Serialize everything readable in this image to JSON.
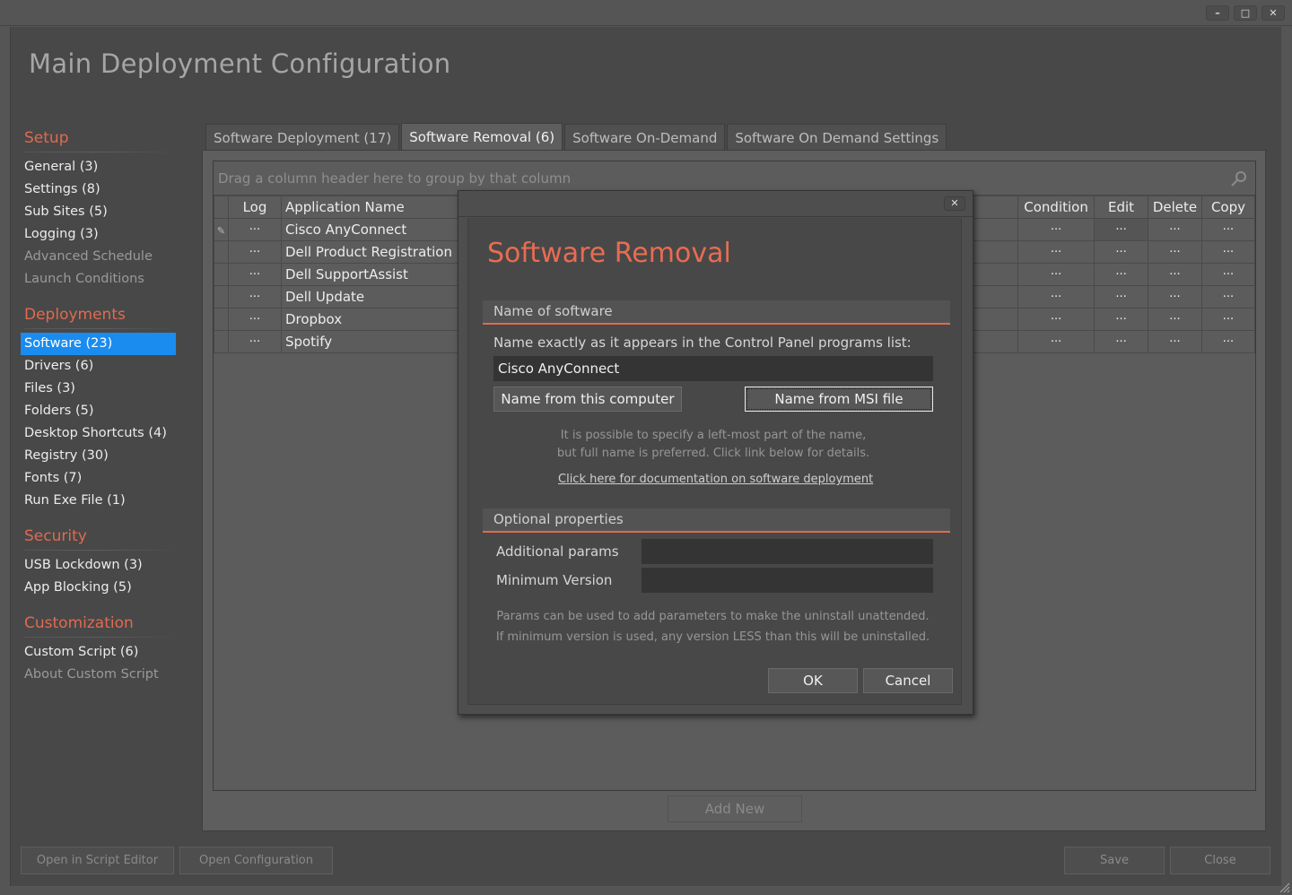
{
  "window": {
    "controls": {
      "minimize": "–",
      "maximize": "□",
      "close": "✕"
    }
  },
  "page_title": "Main Deployment Configuration",
  "colors": {
    "accent": "#e06a50",
    "selection": "#1a8cf0"
  },
  "sidebar": {
    "sections": [
      {
        "title": "Setup",
        "items": [
          {
            "label": "General (3)",
            "state": "normal"
          },
          {
            "label": "Settings (8)",
            "state": "normal"
          },
          {
            "label": "Sub Sites (5)",
            "state": "normal"
          },
          {
            "label": "Logging (3)",
            "state": "normal"
          },
          {
            "label": "Advanced Schedule",
            "state": "dim"
          },
          {
            "label": "Launch Conditions",
            "state": "dim"
          }
        ]
      },
      {
        "title": "Deployments",
        "items": [
          {
            "label": "Software (23)",
            "state": "active"
          },
          {
            "label": "Drivers (6)",
            "state": "normal"
          },
          {
            "label": "Files (3)",
            "state": "normal"
          },
          {
            "label": "Folders (5)",
            "state": "normal"
          },
          {
            "label": "Desktop Shortcuts (4)",
            "state": "normal"
          },
          {
            "label": "Registry (30)",
            "state": "normal"
          },
          {
            "label": "Fonts (7)",
            "state": "normal"
          },
          {
            "label": "Run Exe File (1)",
            "state": "normal"
          }
        ]
      },
      {
        "title": "Security",
        "items": [
          {
            "label": "USB Lockdown (3)",
            "state": "normal"
          },
          {
            "label": "App Blocking (5)",
            "state": "normal"
          }
        ]
      },
      {
        "title": "Customization",
        "items": [
          {
            "label": "Custom Script (6)",
            "state": "normal"
          },
          {
            "label": "About Custom Script",
            "state": "dim"
          }
        ]
      }
    ]
  },
  "tabs": [
    {
      "label": "Software Deployment (17)",
      "active": false
    },
    {
      "label": "Software Removal (6)",
      "active": true
    },
    {
      "label": "Software On-Demand",
      "active": false
    },
    {
      "label": "Software On Demand Settings",
      "active": false
    }
  ],
  "grid": {
    "group_hint": "Drag a column header here to group by that column",
    "search_icon": "search-icon",
    "columns": {
      "log": "Log",
      "name": "Application Name",
      "condition": "Condition",
      "edit": "Edit",
      "delete": "Delete",
      "copy": "Copy"
    },
    "cell_button": "···",
    "edit_row_icon": "pencil-icon",
    "rows": [
      {
        "name": "Cisco AnyConnect"
      },
      {
        "name": "Dell Product Registration"
      },
      {
        "name": "Dell SupportAssist"
      },
      {
        "name": "Dell Update"
      },
      {
        "name": "Dropbox"
      },
      {
        "name": "Spotify"
      }
    ],
    "add_new": "Add New"
  },
  "footer": {
    "open_script_editor": "Open in Script Editor",
    "open_configuration": "Open Configuration",
    "save": "Save",
    "close": "Close"
  },
  "dialog": {
    "close_glyph": "✕",
    "title": "Software Removal",
    "section_name": "Name of software",
    "name_label": "Name exactly as it appears in the Control Panel programs list:",
    "name_value": "Cisco AnyConnect",
    "btn_from_computer": "Name from this computer",
    "btn_from_msi": "Name from MSI file",
    "hint_line1": "It is possible to specify a left-most part of the name,",
    "hint_line2": "but full name is preferred. Click link below for details.",
    "doc_link": "Click here for documentation on software deployment",
    "section_optional": "Optional properties",
    "additional_params_label": "Additional params",
    "additional_params_value": "",
    "min_version_label": "Minimum Version",
    "min_version_value": "",
    "params_hint_line1": "Params can be used to add parameters to make the uninstall unattended.",
    "params_hint_line2": "If minimum version is used, any version LESS than this will be uninstalled.",
    "ok": "OK",
    "cancel": "Cancel"
  }
}
